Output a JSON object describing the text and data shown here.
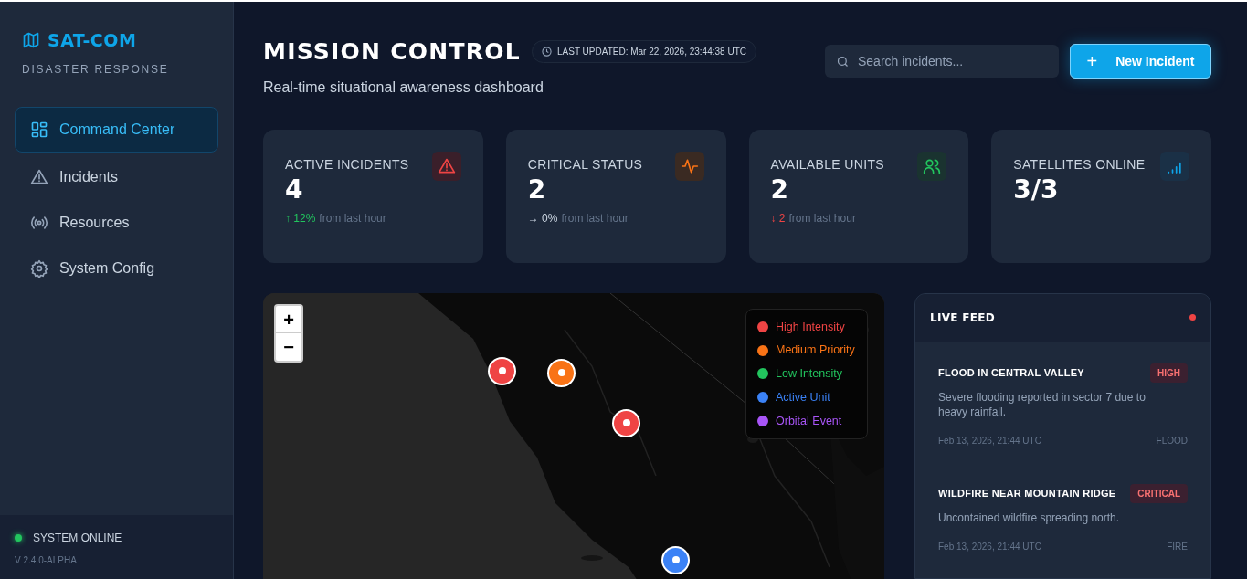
{
  "brand": {
    "name": "SAT-COM",
    "subtitle": "DISASTER RESPONSE"
  },
  "nav": [
    {
      "label": "Command Center",
      "kind": "dashboard",
      "selected": true
    },
    {
      "label": "Incidents",
      "kind": "warning",
      "selected": false
    },
    {
      "label": "Resources",
      "kind": "broadcast",
      "selected": false
    },
    {
      "label": "System Config",
      "kind": "settings",
      "selected": false
    }
  ],
  "system_status": {
    "label": "SYSTEM ONLINE",
    "online": true,
    "version": "V 2.4.0-ALPHA"
  },
  "header": {
    "title": "MISSION CONTROL",
    "last_updated": "LAST UPDATED: Mar 22, 2026, 23:44:38 UTC",
    "subtitle": "Real-time situational awareness dashboard"
  },
  "search": {
    "placeholder": "Search incidents..."
  },
  "new_button": {
    "icon": "+",
    "label": "New Incident"
  },
  "stats": [
    {
      "label": "ACTIVE INCIDENTS",
      "value": "4",
      "kind": "warning",
      "change": {
        "kind": "up",
        "text": "↑ 12%"
      },
      "note": "from last hour"
    },
    {
      "label": "CRITICAL STATUS",
      "value": "2",
      "kind": "pulse",
      "change": {
        "kind": "flat",
        "text": "→ 0%"
      },
      "note": "from last hour"
    },
    {
      "label": "AVAILABLE UNITS",
      "value": "2",
      "kind": "users",
      "change": {
        "kind": "down",
        "text": "↓ 2"
      },
      "note": "from last hour"
    },
    {
      "label": "SATELLITES ONLINE",
      "value": "3/3",
      "kind": "signal"
    }
  ],
  "map": {
    "zoom_in": "+",
    "zoom_out": "−",
    "legend": [
      {
        "label": "High Intensity",
        "color": "#ef4444"
      },
      {
        "label": "Medium Priority",
        "color": "#f97316"
      },
      {
        "label": "Low Intensity",
        "color": "#22c55e"
      },
      {
        "label": "Active Unit",
        "color": "#3b82f6"
      },
      {
        "label": "Orbital Event",
        "color": "#a855f7"
      }
    ],
    "markers": [
      {
        "color": "#ef4444"
      },
      {
        "color": "#f97316"
      },
      {
        "color": "#ef4444"
      },
      {
        "color": "#3b82f6"
      }
    ]
  },
  "live_feed": {
    "title": "LIVE FEED",
    "live": true,
    "items": [
      {
        "title": "FLOOD IN CENTRAL VALLEY",
        "badge": "HIGH",
        "text": "Severe flooding reported in sector 7 due to heavy rainfall.",
        "time": "Feb 13, 2026, 21:44 UTC",
        "category": "FLOOD"
      },
      {
        "title": "WILDFIRE NEAR MOUNTAIN RIDGE",
        "badge": "CRITICAL",
        "text": "Uncontained wildfire spreading north.",
        "time": "Feb 13, 2026, 21:44 UTC",
        "category": "FIRE"
      }
    ]
  }
}
